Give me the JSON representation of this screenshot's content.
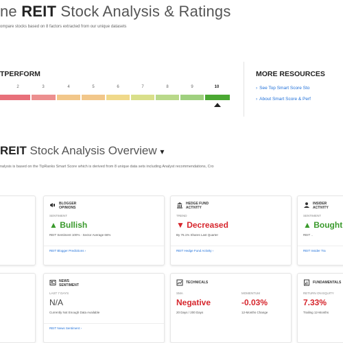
{
  "header": {
    "title_prefix": "ne",
    "title_ticker": "REIT",
    "title_rest": "Stock Analysis & Ratings",
    "subtitle": "ompare stocks based on 8 factors extracted from our unique datasets"
  },
  "smart_score": {
    "label": "TPERFORM",
    "ticks": [
      "2",
      "3",
      "4",
      "5",
      "6",
      "7",
      "8",
      "9",
      "10"
    ],
    "value": 10,
    "colors": [
      "#e8707a",
      "#ec8f8f",
      "#f2c78a",
      "#f2c78a",
      "#f0d98a",
      "#d9df8a",
      "#b9d98a",
      "#9fd07f",
      "#4aa832"
    ]
  },
  "more_resources": {
    "title": "MORE RESOURCES",
    "links": [
      "See Top Smart Score Sto",
      "About Smart Score & Perf"
    ]
  },
  "overview": {
    "title_ticker": "REIT",
    "title_rest": "Stock Analysis Overview",
    "caret": "▾",
    "description": "nalysis is based on the TipRanks Smart Score which is derived from 8 unique data sets including Analyst recommendations, Cro"
  },
  "cards": [
    {
      "id": "blogger",
      "header_lines": [
        "BLOGGER",
        "OPINIONS"
      ],
      "label": "SENTIMENT",
      "value": "▲ Bullish",
      "value_color": "green",
      "detail": "REIT Sentiment 100% · Sector Average 66%",
      "footer": "REIT Blogger Predictions ›"
    },
    {
      "id": "hedge",
      "header_lines": [
        "HEDGE FUND",
        "ACTIVITY"
      ],
      "label": "TREND",
      "value": "▼ Decreased",
      "value_color": "red",
      "detail": "By 76.1% Shares Last Quarter",
      "footer": "REIT Hedge Fund Activity ›"
    },
    {
      "id": "insider",
      "header_lines": [
        "INSIDER",
        "ACTIVITY"
      ],
      "label": "SENTIMENT",
      "value": "▲ Bought",
      "value_color": "green",
      "detail": "REIT ..",
      "footer": "REIT Insider Tra"
    },
    {
      "id": "news",
      "header_lines": [
        "NEWS",
        "SENTIMENT"
      ],
      "label": "LAST 7 DAYS",
      "value": "N/A",
      "value_color": "gray",
      "detail": "Currently Not Enough Data Available",
      "footer": "REIT News Sentiment ›"
    },
    {
      "id": "technicals",
      "header_lines": [
        "TECHNICALS"
      ],
      "label": "SMA",
      "label2": "MOMENTUM",
      "value": "Negative",
      "value_color": "red",
      "value2": "-0.03%",
      "detail": "20 Days / 200 Days",
      "detail2": "12-Months Change",
      "footer": ""
    },
    {
      "id": "fundamentals",
      "header_lines": [
        "FUNDAMENTALS"
      ],
      "label": "RETURN ON EQUITY",
      "value": "7.33%",
      "value_color": "red",
      "detail": "Trailing 12-Months",
      "footer": ""
    }
  ]
}
